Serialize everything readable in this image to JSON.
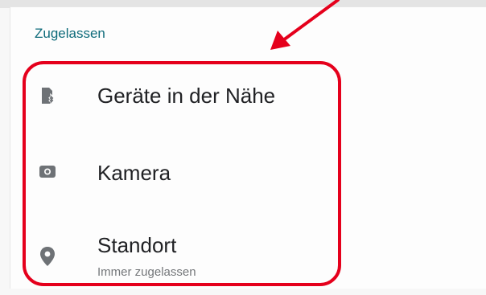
{
  "section": {
    "title": "Zugelassen"
  },
  "permissions": [
    {
      "label": "Geräte in der Nähe",
      "icon": "nearby-devices-icon"
    },
    {
      "label": "Kamera",
      "icon": "camera-icon"
    },
    {
      "label": "Standort",
      "sublabel": "Immer zugelassen",
      "icon": "location-pin-icon"
    }
  ],
  "colors": {
    "accent": "#0e6b7a",
    "icon": "#6e7276",
    "annotation": "#e5001c"
  }
}
